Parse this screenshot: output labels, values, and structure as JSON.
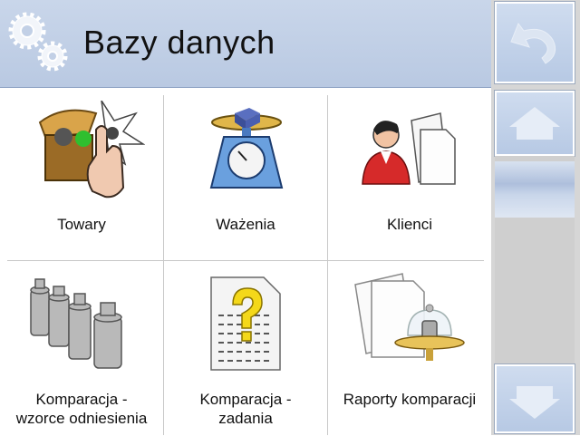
{
  "header": {
    "title": "Bazy danych",
    "gear_icon": "gears-icon"
  },
  "nav": {
    "back_icon": "undo-arrow-icon",
    "up_icon": "arrow-up-icon",
    "down_icon": "arrow-down-icon"
  },
  "tiles": [
    {
      "label": "Towary",
      "icon": "box-hand-icon"
    },
    {
      "label": "Ważenia",
      "icon": "scale-icon"
    },
    {
      "label": "Klienci",
      "icon": "person-documents-icon"
    },
    {
      "label": "Komparacja -\nwzorce odniesienia",
      "line1": "Komparacja -",
      "line2": "wzorce odniesienia",
      "icon": "weights-icon"
    },
    {
      "label": "Komparacja -\nzadania",
      "line1": "Komparacja -",
      "line2": "zadania",
      "icon": "question-document-icon"
    },
    {
      "label": "Raporty komparacji",
      "icon": "weight-report-icon"
    }
  ]
}
